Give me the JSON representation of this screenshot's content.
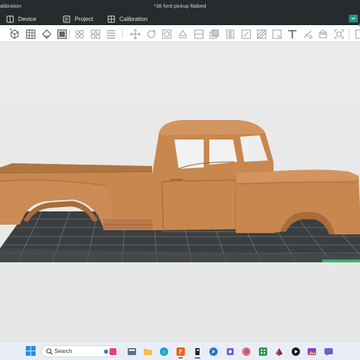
{
  "window": {
    "app_title_fragment": "alibration",
    "document_title": "*38 ford pickup flatbed"
  },
  "tabs": [
    {
      "label": "Device",
      "icon": "cube-icon"
    },
    {
      "label": "Project",
      "icon": "project-icon"
    },
    {
      "label": "Calibration",
      "icon": "calibration-icon"
    }
  ],
  "toolbar": {
    "tools": [
      "add-object-icon",
      "grid-arrange-icon",
      "orient-icon",
      "layers-icon",
      "auto-arrange-icon",
      "split-icon",
      "layer-list-icon",
      "move-icon",
      "rotate-icon",
      "scale-icon",
      "lay-on-face-icon",
      "cut-icon",
      "boolean-icon",
      "support-paint-icon",
      "seam-paint-icon",
      "fuzzy-skin-icon",
      "measure-icon",
      "text-icon",
      "color-paint-icon",
      "assembly-icon",
      "fit-icon"
    ]
  },
  "colors": {
    "title_bar": "#262b2e",
    "accent": "#0e9a86",
    "model": "#c7874f",
    "bed_dark": "#3b3f42",
    "bed_grid": "#8a8f93",
    "viewport_bg": "#e8e8e8"
  },
  "taskbar": {
    "search_placeholder": "Search",
    "apps": [
      "file-manager-icon",
      "folder-icon",
      "edge-icon",
      "app-store-icon",
      "3d-slicer-icon",
      "terminal-icon",
      "firefox-icon",
      "calculator-icon",
      "paint-icon",
      "media-player-icon",
      "photos-icon",
      "chat-icon"
    ]
  }
}
